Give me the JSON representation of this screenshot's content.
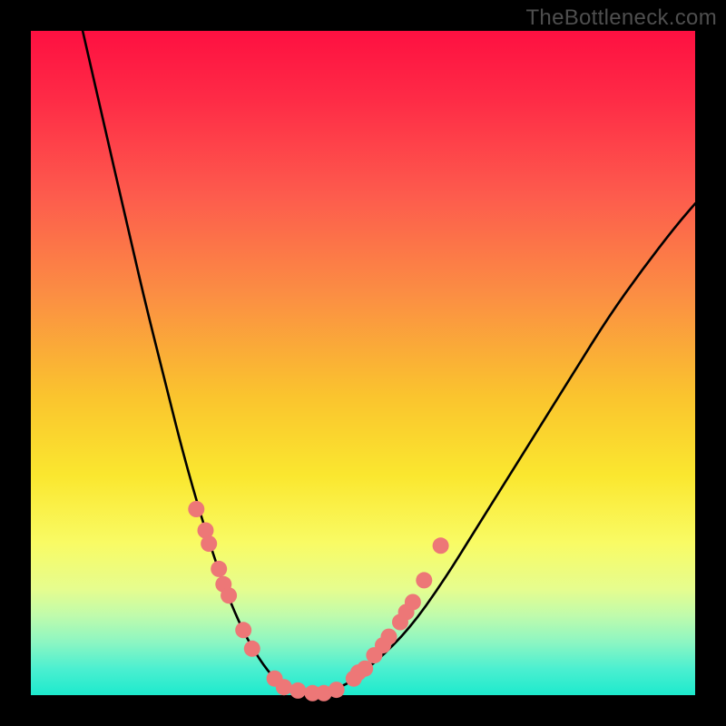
{
  "credit_text": "TheBottleneck.com",
  "colors": {
    "frame": "#000000",
    "curve_line": "#000000",
    "marker_fill": "#ed7777",
    "gradient_stops": [
      "#fe1041",
      "#fe2a46",
      "#fd5c4d",
      "#fb8f43",
      "#fac42e",
      "#fae72f",
      "#f9fb64",
      "#e6fd8e",
      "#c0fbac",
      "#8df6c2",
      "#4cefd0",
      "#1deacd"
    ]
  },
  "chart_data": {
    "type": "line",
    "title": "",
    "xlabel": "",
    "ylabel": "",
    "xlim": [
      0,
      1
    ],
    "ylim": [
      0,
      1
    ],
    "note": "Axes are unitless/unlabeled; values estimated from pixel positions normalized to the inner 732x732 plot area with origin at bottom-left.",
    "series": [
      {
        "name": "v-curve-left",
        "x": [
          0.078,
          0.11,
          0.14,
          0.17,
          0.2,
          0.225,
          0.25,
          0.275,
          0.3,
          0.325,
          0.35,
          0.375
        ],
        "y": [
          1.0,
          0.86,
          0.73,
          0.6,
          0.48,
          0.38,
          0.29,
          0.21,
          0.14,
          0.085,
          0.045,
          0.015
        ]
      },
      {
        "name": "v-curve-bottom",
        "x": [
          0.375,
          0.4,
          0.425,
          0.45,
          0.475
        ],
        "y": [
          0.015,
          0.005,
          0.0,
          0.005,
          0.017
        ]
      },
      {
        "name": "v-curve-right",
        "x": [
          0.475,
          0.52,
          0.57,
          0.62,
          0.67,
          0.72,
          0.77,
          0.82,
          0.87,
          0.92,
          0.97,
          1.0
        ],
        "y": [
          0.017,
          0.05,
          0.1,
          0.17,
          0.25,
          0.33,
          0.41,
          0.49,
          0.57,
          0.64,
          0.705,
          0.74
        ]
      }
    ],
    "markers": {
      "count": 25,
      "name": "salmon-marker",
      "color": "#ed7777",
      "radius_px_approx": 9,
      "points_xy": [
        [
          0.249,
          0.28
        ],
        [
          0.263,
          0.248
        ],
        [
          0.268,
          0.228
        ],
        [
          0.283,
          0.19
        ],
        [
          0.29,
          0.167
        ],
        [
          0.298,
          0.15
        ],
        [
          0.32,
          0.098
        ],
        [
          0.333,
          0.07
        ],
        [
          0.367,
          0.025
        ],
        [
          0.381,
          0.012
        ],
        [
          0.402,
          0.007
        ],
        [
          0.424,
          0.003
        ],
        [
          0.441,
          0.003
        ],
        [
          0.46,
          0.008
        ],
        [
          0.486,
          0.025
        ],
        [
          0.493,
          0.034
        ],
        [
          0.503,
          0.04
        ],
        [
          0.517,
          0.06
        ],
        [
          0.53,
          0.075
        ],
        [
          0.539,
          0.088
        ],
        [
          0.556,
          0.11
        ],
        [
          0.565,
          0.125
        ],
        [
          0.575,
          0.14
        ],
        [
          0.592,
          0.173
        ],
        [
          0.617,
          0.225
        ]
      ]
    }
  }
}
